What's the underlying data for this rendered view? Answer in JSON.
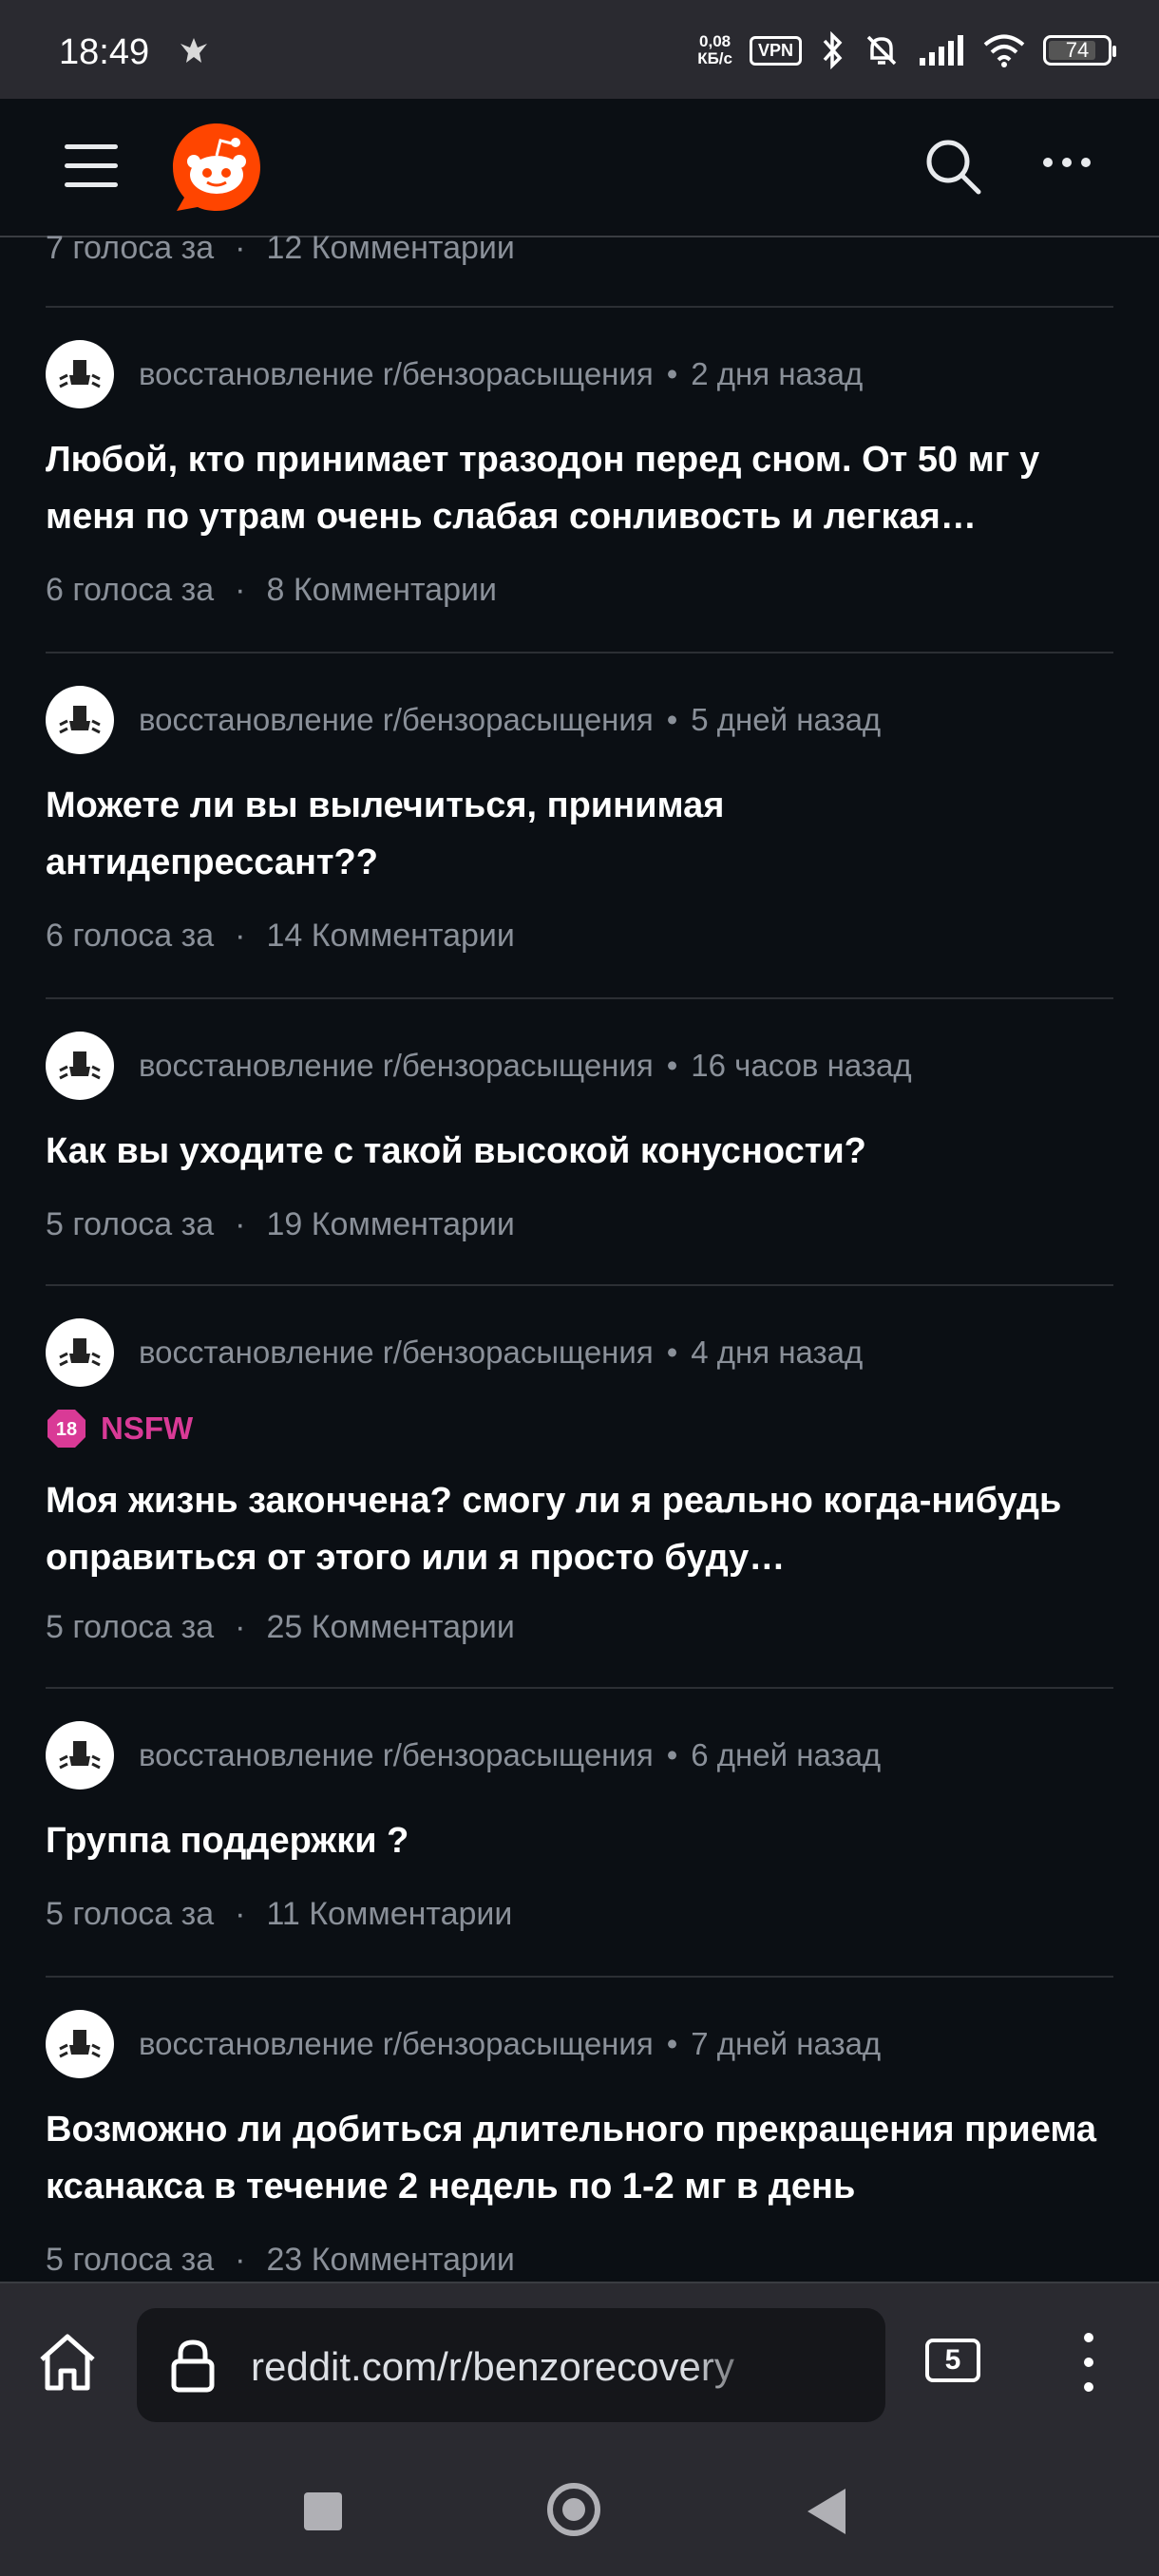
{
  "status_bar": {
    "time": "18:49",
    "net_speed_value": "0,08",
    "net_speed_unit": "КБ/с",
    "vpn": "VPN",
    "battery": "74",
    "battery_level_percent": 74
  },
  "header": {
    "icons": [
      "hamburger-icon",
      "reddit-logo",
      "search-icon",
      "more-icon"
    ]
  },
  "feed": {
    "first_partial": {
      "votes": "7 голоса за",
      "comments": "12 Комментарии"
    },
    "posts": [
      {
        "subreddit": "восстановление r/бензорасыщения",
        "time": "2 дня назад",
        "title": "Любой, кто принимает тразодон перед сном. От 50 мг у меня по утрам очень слабая сонливость и легкая…",
        "votes": "6 голоса за",
        "comments": "8 Комментарии"
      },
      {
        "subreddit": "восстановление r/бензорасыщения",
        "time": "5 дней назад",
        "title": "Можете ли вы вылечиться, принимая антидепрессант??",
        "votes": "6 голоса за",
        "comments": "14 Комментарии"
      },
      {
        "subreddit": "восстановление r/бензорасыщения",
        "time": "16 часов назад",
        "title": "Как вы уходите с такой высокой конусности?",
        "votes": "5 голоса за",
        "comments": "19 Комментарии"
      },
      {
        "subreddit": "восстановление r/бензорасыщения",
        "time": "4 дня назад",
        "nsfw_badge": "18",
        "nsfw_label": "NSFW",
        "title": "Моя жизнь закончена? смогу ли я реально когда-нибудь оправиться от этого или я просто буду…",
        "votes": "5 голоса за",
        "comments": "25 Комментарии"
      },
      {
        "subreddit": "восстановление r/бензорасыщения",
        "time": "6 дней назад",
        "title": "Группа поддержки ?",
        "votes": "5 голоса за",
        "comments": "11 Комментарии"
      },
      {
        "subreddit": "восстановление r/бензорасыщения",
        "time": "7 дней назад",
        "title": "Возможно ли добиться длительного прекращения приема ксанакса в течение 2 недель по 1-2 мг в день",
        "votes": "5 голоса за",
        "comments": "23 Комментарии"
      }
    ],
    "separator": "·",
    "meta_separator": "•"
  },
  "browser": {
    "url": "reddit.com/r/benzorecovery",
    "tab_count": "5"
  },
  "colors": {
    "background": "#0b0f14",
    "reddit_orange": "#ff4500",
    "nsfw_pink": "#d93a96",
    "muted_text": "#8a9099"
  }
}
